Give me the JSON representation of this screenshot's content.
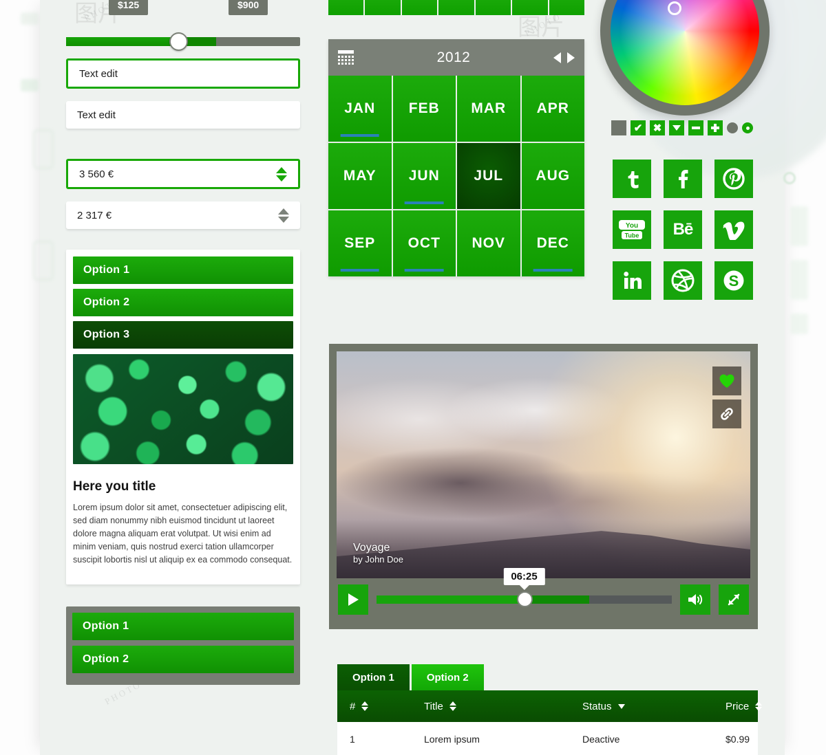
{
  "theme": {
    "green": "#17a40c",
    "dark_green": "#0a4f02",
    "grey": "#6f756b",
    "blue_marker": "#2a82b8",
    "page_bg": "#eef2ef"
  },
  "watermark": {
    "text": "PHOTO",
    "glyph": "图片"
  },
  "price_slider": {
    "name": "price-range-slider",
    "min_label": "$125",
    "max_label": "$900",
    "fill_percent": 64
  },
  "inputs": {
    "text_focused": {
      "value": "Text edit",
      "placeholder": "Text edit"
    },
    "text_normal": {
      "value": "Text edit",
      "placeholder": "Text edit"
    },
    "spinner_focused": {
      "value": "3 560 €"
    },
    "spinner_normal": {
      "value": "2 317 €"
    }
  },
  "accordion": {
    "options": [
      "Option 1",
      "Option 2",
      "Option 3"
    ],
    "selected_index": 2,
    "card": {
      "image_alt": "green-leaves-photo",
      "title": "Here you title",
      "body": "Lorem ipsum dolor sit amet, consectetuer adipiscing elit, sed diam nonummy nibh euismod tincidunt ut laoreet dolore magna aliquam erat volutpat. Ut wisi enim ad minim veniam, quis nostrud exerci tation ullamcorper suscipit lobortis nisl ut aliquip ex ea commodo consequat."
    }
  },
  "option_panel_grey": {
    "options": [
      "Option 1",
      "Option 2"
    ]
  },
  "calendar": {
    "icon": "calendar-icon",
    "year": "2012",
    "prev_label": "◀",
    "next_label": "▶",
    "months": [
      "JAN",
      "FEB",
      "MAR",
      "APR",
      "MAY",
      "JUN",
      "JUL",
      "AUG",
      "SEP",
      "OCT",
      "NOV",
      "DEC"
    ],
    "selected": "JUL",
    "marked": [
      "JAN",
      "JUN",
      "SEP",
      "OCT",
      "DEC"
    ]
  },
  "color_wheel": {
    "name": "color-wheel",
    "picker": "color-picker-handle"
  },
  "checkbox_row": [
    {
      "name": "checkbox-unchecked",
      "state": "off",
      "glyph": ""
    },
    {
      "name": "checkbox-checked",
      "state": "on",
      "glyph": "✔"
    },
    {
      "name": "checkbox-cross",
      "state": "on",
      "glyph": "✖"
    },
    {
      "name": "checkbox-caret-down",
      "state": "on",
      "glyph": "caret"
    },
    {
      "name": "checkbox-minus",
      "state": "on",
      "glyph": "minus"
    },
    {
      "name": "checkbox-plus",
      "state": "on",
      "glyph": "plus"
    },
    {
      "name": "radio-unselected",
      "state": "off",
      "glyph": "dot"
    },
    {
      "name": "radio-selected",
      "state": "on",
      "glyph": "dot"
    }
  ],
  "social_icons": [
    {
      "name": "twitter-icon",
      "label": "t"
    },
    {
      "name": "facebook-icon",
      "label": "f"
    },
    {
      "name": "pinterest-icon",
      "label": "P"
    },
    {
      "name": "youtube-icon",
      "label": "You Tube"
    },
    {
      "name": "behance-icon",
      "label": "Bē"
    },
    {
      "name": "vimeo-icon",
      "label": "v"
    },
    {
      "name": "linkedin-icon",
      "label": "in"
    },
    {
      "name": "dribbble-icon",
      "label": "dribbble"
    },
    {
      "name": "skype-icon",
      "label": "S"
    }
  ],
  "player": {
    "title": "Voyage",
    "author": "by John Doe",
    "time": "06:25",
    "progress_percent": 50,
    "buffered_percent": 72,
    "play_label": "play-icon",
    "volume_label": "volume-icon",
    "fullscreen_label": "fullscreen-icon",
    "like_label": "heart-icon",
    "link_label": "link-icon"
  },
  "table": {
    "tabs": [
      {
        "label": "Option 1",
        "active": true
      },
      {
        "label": "Option 2",
        "active": false
      }
    ],
    "columns": [
      "#",
      "Title",
      "Status",
      "Price"
    ],
    "rows": [
      {
        "num": "1",
        "title": "Lorem ipsum",
        "status": "Deactive",
        "price": "$0.99"
      }
    ]
  }
}
